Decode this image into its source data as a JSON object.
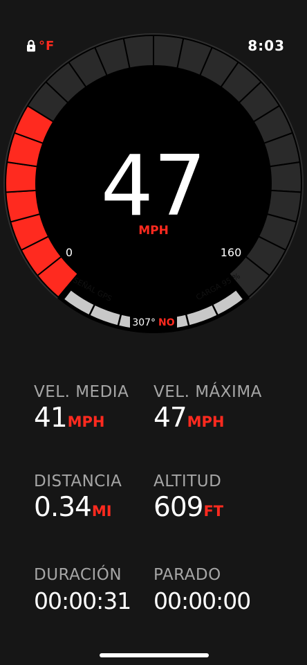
{
  "status_bar": {
    "lock_icon": "lock-icon",
    "temperature_unit": "°F",
    "time": "8:03"
  },
  "speedometer": {
    "speed": "47",
    "unit": "MPH",
    "scale_min": "0",
    "scale_max": "160",
    "speed_value": 47,
    "scale_max_value": 160,
    "gps_label": "SEÑAL GPS",
    "battery_label": "CARGA 95 %",
    "heading_degrees": "307°",
    "heading_direction": "NO",
    "colors": {
      "active": "#ff2a1f",
      "inactive": "#2a2a2a",
      "info_segments": "#c8c8c8"
    }
  },
  "stats": {
    "avg_speed": {
      "label": "VEL. MEDIA",
      "value": "41",
      "unit": "MPH"
    },
    "max_speed": {
      "label": "VEL. MÁXIMA",
      "value": "47",
      "unit": "MPH"
    },
    "distance": {
      "label": "DISTANCIA",
      "value": "0.34",
      "unit": "MI"
    },
    "altitude": {
      "label": "ALTITUD",
      "value": "609",
      "unit": "FT"
    },
    "duration": {
      "label": "DURACIÓN",
      "value": "00:00:31"
    },
    "stopped": {
      "label": "PARADO",
      "value": "00:00:00"
    }
  }
}
